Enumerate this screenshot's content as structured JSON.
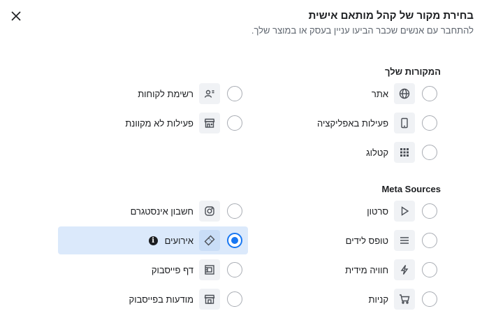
{
  "header": {
    "title": "בחירת מקור של קהל מותאם אישית",
    "subtitle": "להתחבר עם אנשים שכבר הביעו עניין בעסק או במוצר שלך."
  },
  "sections": {
    "own_title": "המקורות שלך",
    "meta_title": "Meta Sources"
  },
  "options": {
    "website": {
      "label": "אתר",
      "icon": "globe-icon"
    },
    "app_activity": {
      "label": "פעילות באפליקציה",
      "icon": "mobile-icon"
    },
    "catalog": {
      "label": "קטלוג",
      "icon": "grid-icon"
    },
    "customer_list": {
      "label": "רשימת לקוחות",
      "icon": "contact-list-icon"
    },
    "offline_activity": {
      "label": "פעילות לא מקוונת",
      "icon": "store-icon"
    },
    "video": {
      "label": "סרטון",
      "icon": "play-icon"
    },
    "lead_form": {
      "label": "טופס לידים",
      "icon": "lines-icon"
    },
    "instant_experience": {
      "label": "חוויה מידית",
      "icon": "lightning-icon"
    },
    "shopping": {
      "label": "קניות",
      "icon": "cart-icon"
    },
    "instagram_account": {
      "label": "חשבון אינסטגרם",
      "icon": "instagram-icon"
    },
    "events": {
      "label": "אירועים",
      "icon": "ticket-icon",
      "selected": true
    },
    "facebook_page": {
      "label": "דף פייסבוק",
      "icon": "page-icon"
    },
    "facebook_listings": {
      "label": "מודעות בפייסבוק",
      "icon": "shop-icon"
    }
  },
  "accent_color": "#1877f2"
}
